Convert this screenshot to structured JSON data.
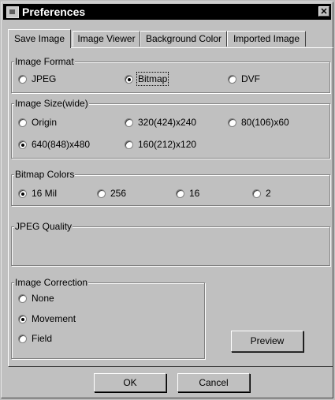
{
  "window": {
    "title": "Preferences",
    "close_glyph": "✕"
  },
  "tabs": [
    {
      "label": "Save Image"
    },
    {
      "label": "Image Viewer"
    },
    {
      "label": "Background Color"
    },
    {
      "label": "Imported Image"
    }
  ],
  "image_format": {
    "legend": "Image Format",
    "options": [
      {
        "label": "JPEG",
        "selected": false
      },
      {
        "label": "Bitmap",
        "selected": true
      },
      {
        "label": "DVF",
        "selected": false
      }
    ]
  },
  "image_size": {
    "legend": "Image Size(wide)",
    "options": [
      {
        "label": "Origin",
        "selected": false
      },
      {
        "label": "320(424)x240",
        "selected": false
      },
      {
        "label": "80(106)x60",
        "selected": false
      },
      {
        "label": "640(848)x480",
        "selected": true
      },
      {
        "label": "160(212)x120",
        "selected": false
      }
    ]
  },
  "bitmap_colors": {
    "legend": "Bitmap Colors",
    "options": [
      {
        "label": "16 Mil",
        "selected": true
      },
      {
        "label": "256",
        "selected": false
      },
      {
        "label": "16",
        "selected": false
      },
      {
        "label": "2",
        "selected": false
      }
    ]
  },
  "jpeg_quality": {
    "legend": "JPEG Quality"
  },
  "image_correction": {
    "legend": "Image Correction",
    "options": [
      {
        "label": "None",
        "selected": false
      },
      {
        "label": "Movement",
        "selected": true
      },
      {
        "label": "Field",
        "selected": false
      }
    ]
  },
  "buttons": {
    "preview": "Preview",
    "ok": "OK",
    "cancel": "Cancel"
  }
}
